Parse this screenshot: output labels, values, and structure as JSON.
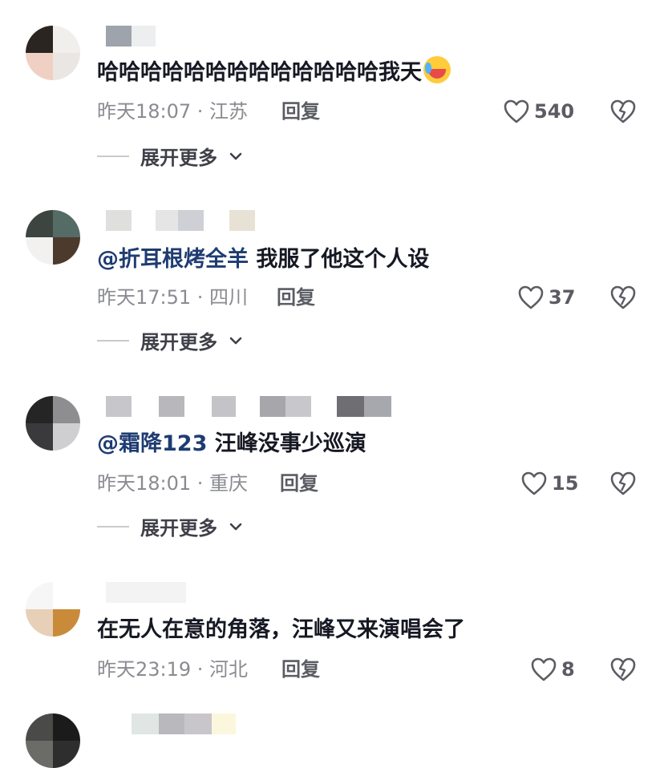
{
  "comments": [
    {
      "text_main": "哈哈哈哈哈哈哈哈哈哈哈哈哈我天",
      "emoji": "crying-laughing-emoji",
      "time": "昨天18:07 · 江苏",
      "reply": "回复",
      "likes": "540",
      "expand": "展开更多"
    },
    {
      "mention": "@折耳根烤全羊",
      "text_main": " 我服了他这个人设",
      "time": "昨天17:51 · 四川",
      "reply": "回复",
      "likes": "37",
      "expand": "展开更多"
    },
    {
      "mention": "@霜降123",
      "text_main": " 汪峰没事少巡演",
      "time": "昨天18:01 · 重庆",
      "reply": "回复",
      "likes": "15",
      "expand": "展开更多"
    },
    {
      "text_main": "在无人在意的角落，汪峰又来演唱会了",
      "time": "昨天23:19 · 河北",
      "reply": "回复",
      "likes": "8"
    }
  ],
  "colors": {
    "mention": "#1f3c72",
    "meta": "#8a8b91",
    "text": "#161823"
  },
  "icons": {
    "like": "heart-outline-icon",
    "dislike": "broken-heart-icon",
    "expand": "chevron-down-icon"
  }
}
